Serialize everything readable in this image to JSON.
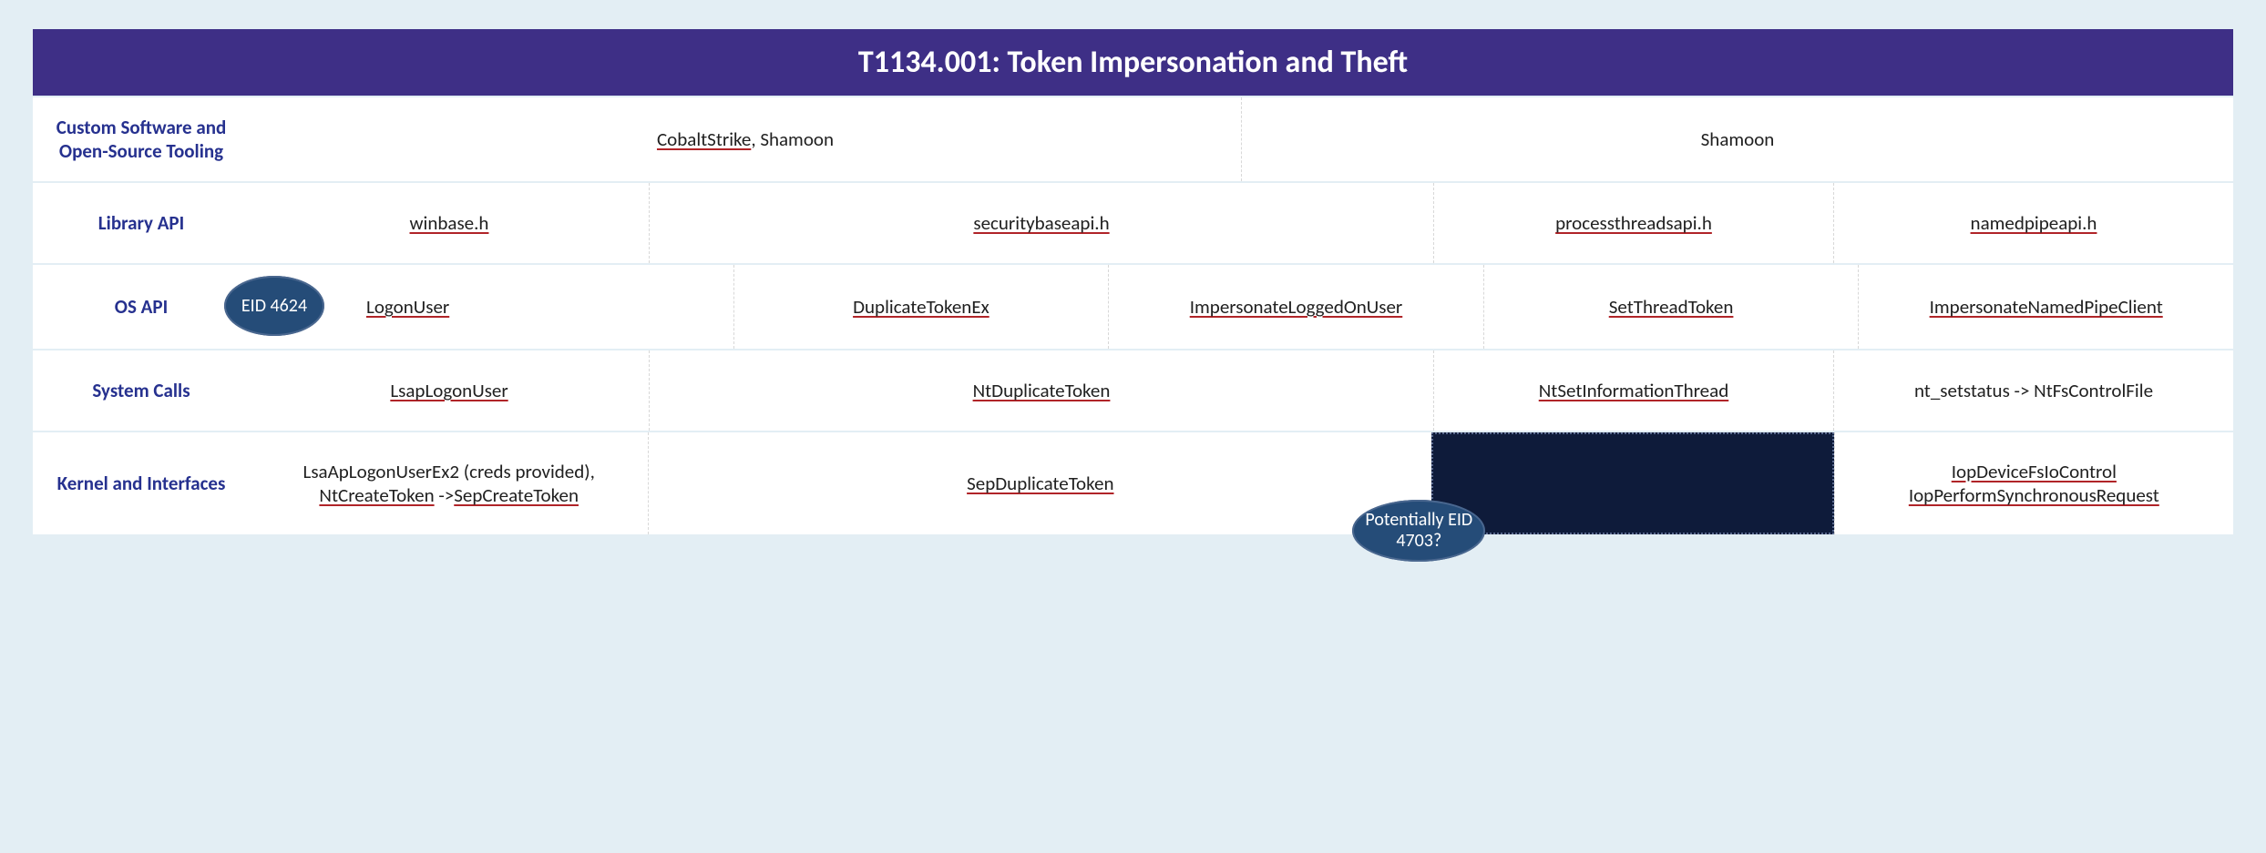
{
  "title": "T1134.001: Token Impersonation and Theft",
  "rows": {
    "tooling": {
      "label": "Custom Software and Open-Source Tooling",
      "cells": {
        "c1_u": "CobaltStrike",
        "c1_rest": ", Shamoon",
        "c2": "Shamoon"
      }
    },
    "library": {
      "label": "Library API",
      "cells": {
        "c1": "winbase.h",
        "c2": "securitybaseapi.h",
        "c3": "processthreadsapi.h",
        "c4": "namedpipeapi.h"
      }
    },
    "os": {
      "label": "OS API",
      "badge": "EID 4624",
      "cells": {
        "c1": "LogonUser",
        "c2": "DuplicateTokenEx",
        "c3": "ImpersonateLoggedOnUser",
        "c4": "SetThreadToken",
        "c5": "ImpersonateNamedPipeClient"
      }
    },
    "sys": {
      "label": "System Calls",
      "cells": {
        "c1": "LsapLogonUser",
        "c2": "NtDuplicateToken",
        "c3": "NtSetInformationThread",
        "c4": "nt_setstatus -> NtFsControlFile"
      }
    },
    "kernel": {
      "label": "Kernel and Interfaces",
      "badge": "Potentially EID 4703?",
      "cells": {
        "c1a": "LsaApLogonUserEx2 (creds provided),",
        "c1b_u1": "NtCreateToken",
        "c1b_mid": " ->",
        "c1b_u2": "SepCreateToken",
        "c2": "SepDuplicateToken",
        "c4a": "IopDeviceFsIoControl",
        "c4b": "IopPerformSynchronousRequest"
      }
    }
  }
}
